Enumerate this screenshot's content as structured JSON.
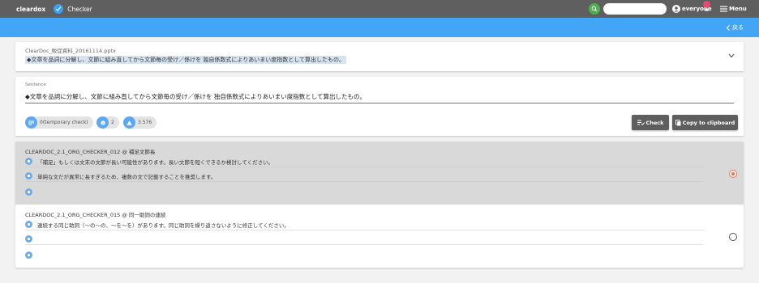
{
  "header": {
    "brand": "cleardox",
    "app_name": "Checker",
    "search_placeholder": "",
    "user_name": "everyone",
    "menu_label": "Menu"
  },
  "subheader": {
    "back_label": "戻る"
  },
  "document": {
    "file_name": "ClearDoc_販促資料_20161114.pptx",
    "sentence": "◆文章を品詞に分解し、文節に組み直してから文節毎の受け／係けを 独自係数式によりあいまい度指数として算出したもの。"
  },
  "editor": {
    "label": "Sentence",
    "text": "◆文章を品詞に分解し、文節に組み直してから文節毎の受け／係けを 独自係数式によりあいまい度指数として算出したもの。",
    "chips": {
      "temporary_check": "0(temporary check)",
      "count": "2",
      "score": "3.576"
    },
    "check_button": "Check",
    "copy_button": "Copy to clipboard"
  },
  "results": [
    {
      "title": "CLEARDOC_2.1_ORG_CHECKER_012 @ 補足文節長",
      "lines": [
        "「補足」もしくは文末の文節が長い可能性があります。長い文節を短くできるか検討してください。",
        "単純な文だが異常に長すぎるため、複数の文で記載することを推奨します。",
        ""
      ],
      "selected": true
    },
    {
      "title": "CLEARDOC_2.1_ORG_CHECKER_015 @ 同一助詞の連続",
      "lines": [
        "連続する同じ助詞（〜の〜の、〜を〜を）があります。同じ助詞を繰り返さないように修正してください。",
        "",
        ""
      ],
      "selected": false
    }
  ],
  "colors": {
    "topbar": "#5f5f5f",
    "accent_blue": "#42a5f5",
    "search_green": "#4caf50",
    "badge_pink": "#e84a6b",
    "radio_selected": "#f26d4f"
  }
}
